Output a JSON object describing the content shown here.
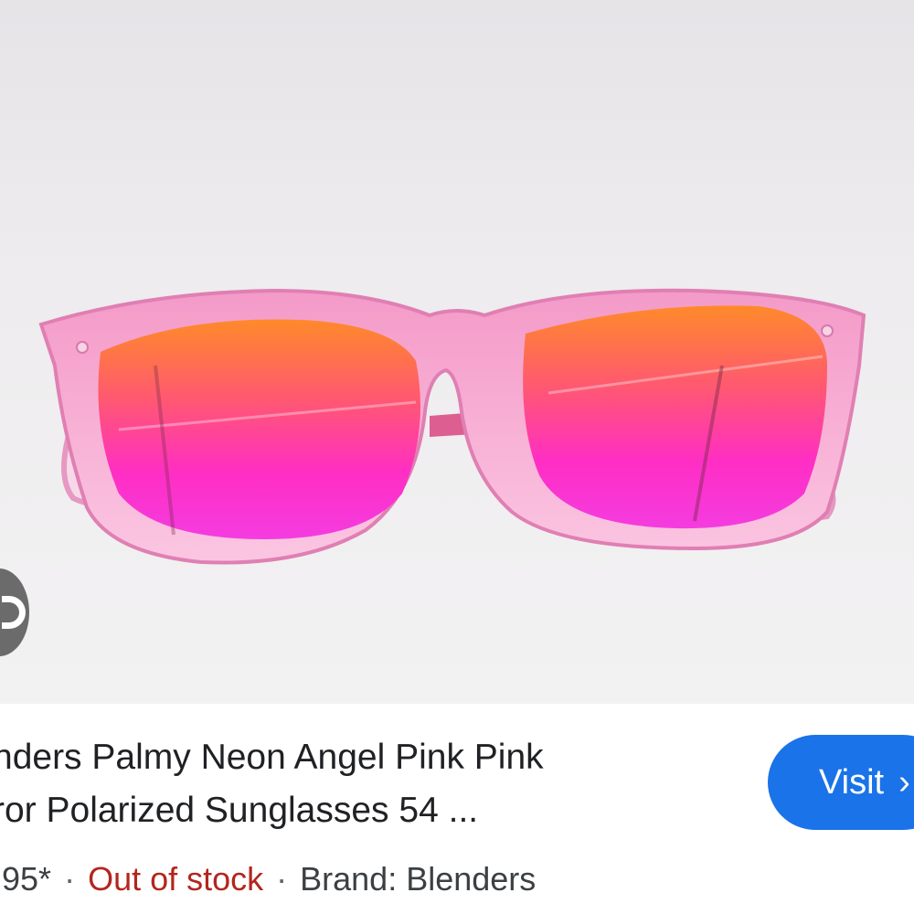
{
  "product": {
    "title_line1": "nders Palmy Neon Angel Pink Pink",
    "title_line2": "ror Polarized Sunglasses 54 ...",
    "price": ".95*",
    "stock_status": "Out of stock",
    "brand": "Brand: Blenders",
    "separator": "·"
  },
  "actions": {
    "visit_label": "Visit",
    "visit_arrow": "›"
  },
  "icons": {
    "lens": "google-lens-icon",
    "visit_arrow": "chevron-right-icon"
  },
  "colors": {
    "accent": "#1a73e8",
    "out_of_stock": "#b3261e",
    "frame": "#f6a9cf",
    "lens_top": "#ff9a2e",
    "lens_bottom": "#ff2fc2"
  }
}
